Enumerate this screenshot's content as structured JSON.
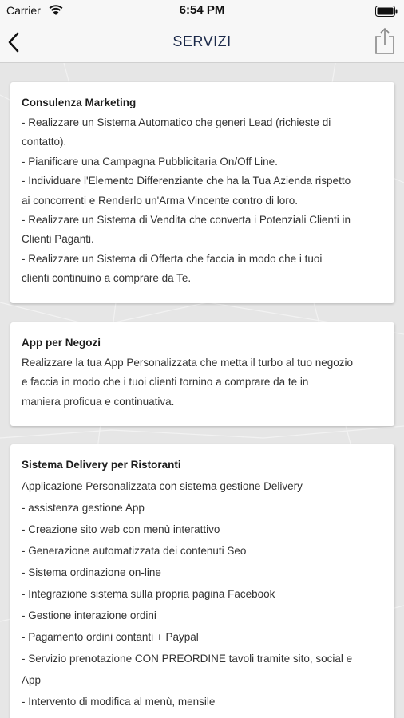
{
  "status_bar": {
    "carrier": "Carrier",
    "time": "6:54 PM"
  },
  "nav": {
    "title": "SERVIZI",
    "back_icon": "chevron-left-icon",
    "share_icon": "share-icon",
    "title_color": "#1c2a4a"
  },
  "cards": [
    {
      "title": "Consulenza Marketing",
      "lines": [
        "- Realizzare un Sistema Automatico che generi Lead (richieste di",
        "contatto).",
        "- Pianificare una Campagna Pubblicitaria On/Off Line.",
        "- Individuare l'Elemento Differenziante che ha la Tua Azienda rispetto",
        "ai concorrenti e Renderlo un'Arma Vincente contro di loro.",
        "- Realizzare un Sistema di Vendita che converta i Potenziali Clienti in",
        "Clienti Paganti.",
        "- Realizzare un Sistema di Offerta che faccia in modo che i tuoi",
        "clienti continuino a comprare da Te."
      ]
    },
    {
      "title": "App per Negozi",
      "lines": [
        "Realizzare la tua App Personalizzata che metta il turbo al tuo negozio",
        "e faccia in modo che i tuoi clienti tornino a comprare da te in",
        "maniera proficua e continuativa."
      ]
    },
    {
      "title": "Sistema Delivery per Ristoranti",
      "lines": [
        "Applicazione Personalizzata con sistema gestione Delivery",
        "- assistenza gestione App",
        "- Creazione sito web con menù interattivo",
        "- Generazione automatizzata dei contenuti Seo",
        "- Sistema ordinazione on-line",
        "- Integrazione sistema sulla propria pagina Facebook",
        "- Gestione interazione ordini",
        "- Pagamento ordini contanti + Paypal",
        "- Servizio prenotazione CON PREORDINE tavoli tramite sito, social e",
        "App",
        "- Intervento di modifica al menù, mensile"
      ]
    }
  ]
}
